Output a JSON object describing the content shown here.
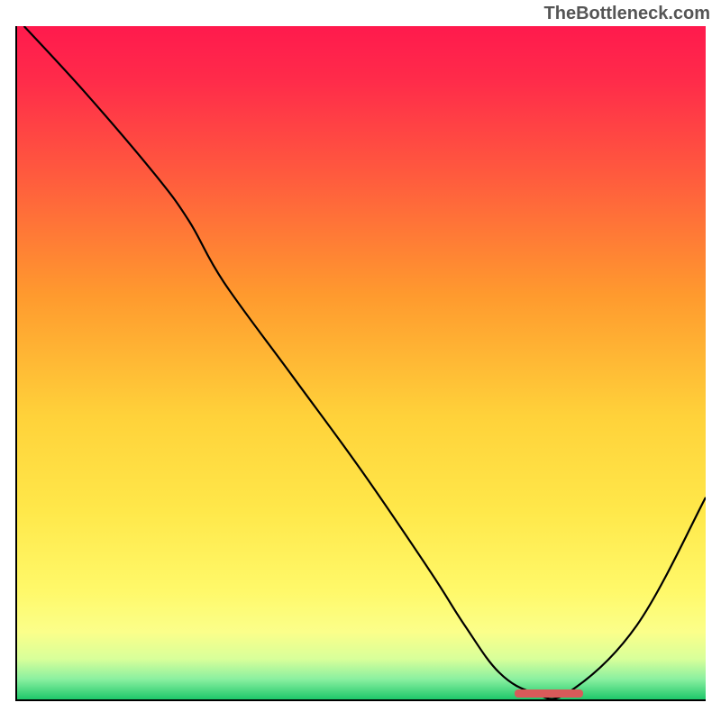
{
  "watermark": "TheBottleneck.com",
  "chart_data": {
    "type": "line",
    "title": "",
    "xlabel": "",
    "ylabel": "",
    "xlim": [
      0,
      100
    ],
    "ylim": [
      0,
      100
    ],
    "x": [
      1,
      10,
      20,
      25,
      30,
      40,
      50,
      60,
      65,
      70,
      75,
      80,
      90,
      100
    ],
    "values": [
      100,
      90,
      78,
      71,
      62,
      48,
      34,
      19,
      11,
      4,
      1,
      1,
      11,
      30
    ],
    "optimal_range": [
      72,
      82
    ],
    "gradient_stops": [
      {
        "pos": 0.0,
        "color": "#ff1a4d"
      },
      {
        "pos": 0.08,
        "color": "#ff2b4a"
      },
      {
        "pos": 0.22,
        "color": "#ff5a3e"
      },
      {
        "pos": 0.4,
        "color": "#ff9a2e"
      },
      {
        "pos": 0.58,
        "color": "#ffd23a"
      },
      {
        "pos": 0.72,
        "color": "#ffe84a"
      },
      {
        "pos": 0.84,
        "color": "#fff96a"
      },
      {
        "pos": 0.9,
        "color": "#fbff8a"
      },
      {
        "pos": 0.94,
        "color": "#d8ff9a"
      },
      {
        "pos": 0.97,
        "color": "#8af0a0"
      },
      {
        "pos": 1.0,
        "color": "#1ec76a"
      }
    ]
  }
}
